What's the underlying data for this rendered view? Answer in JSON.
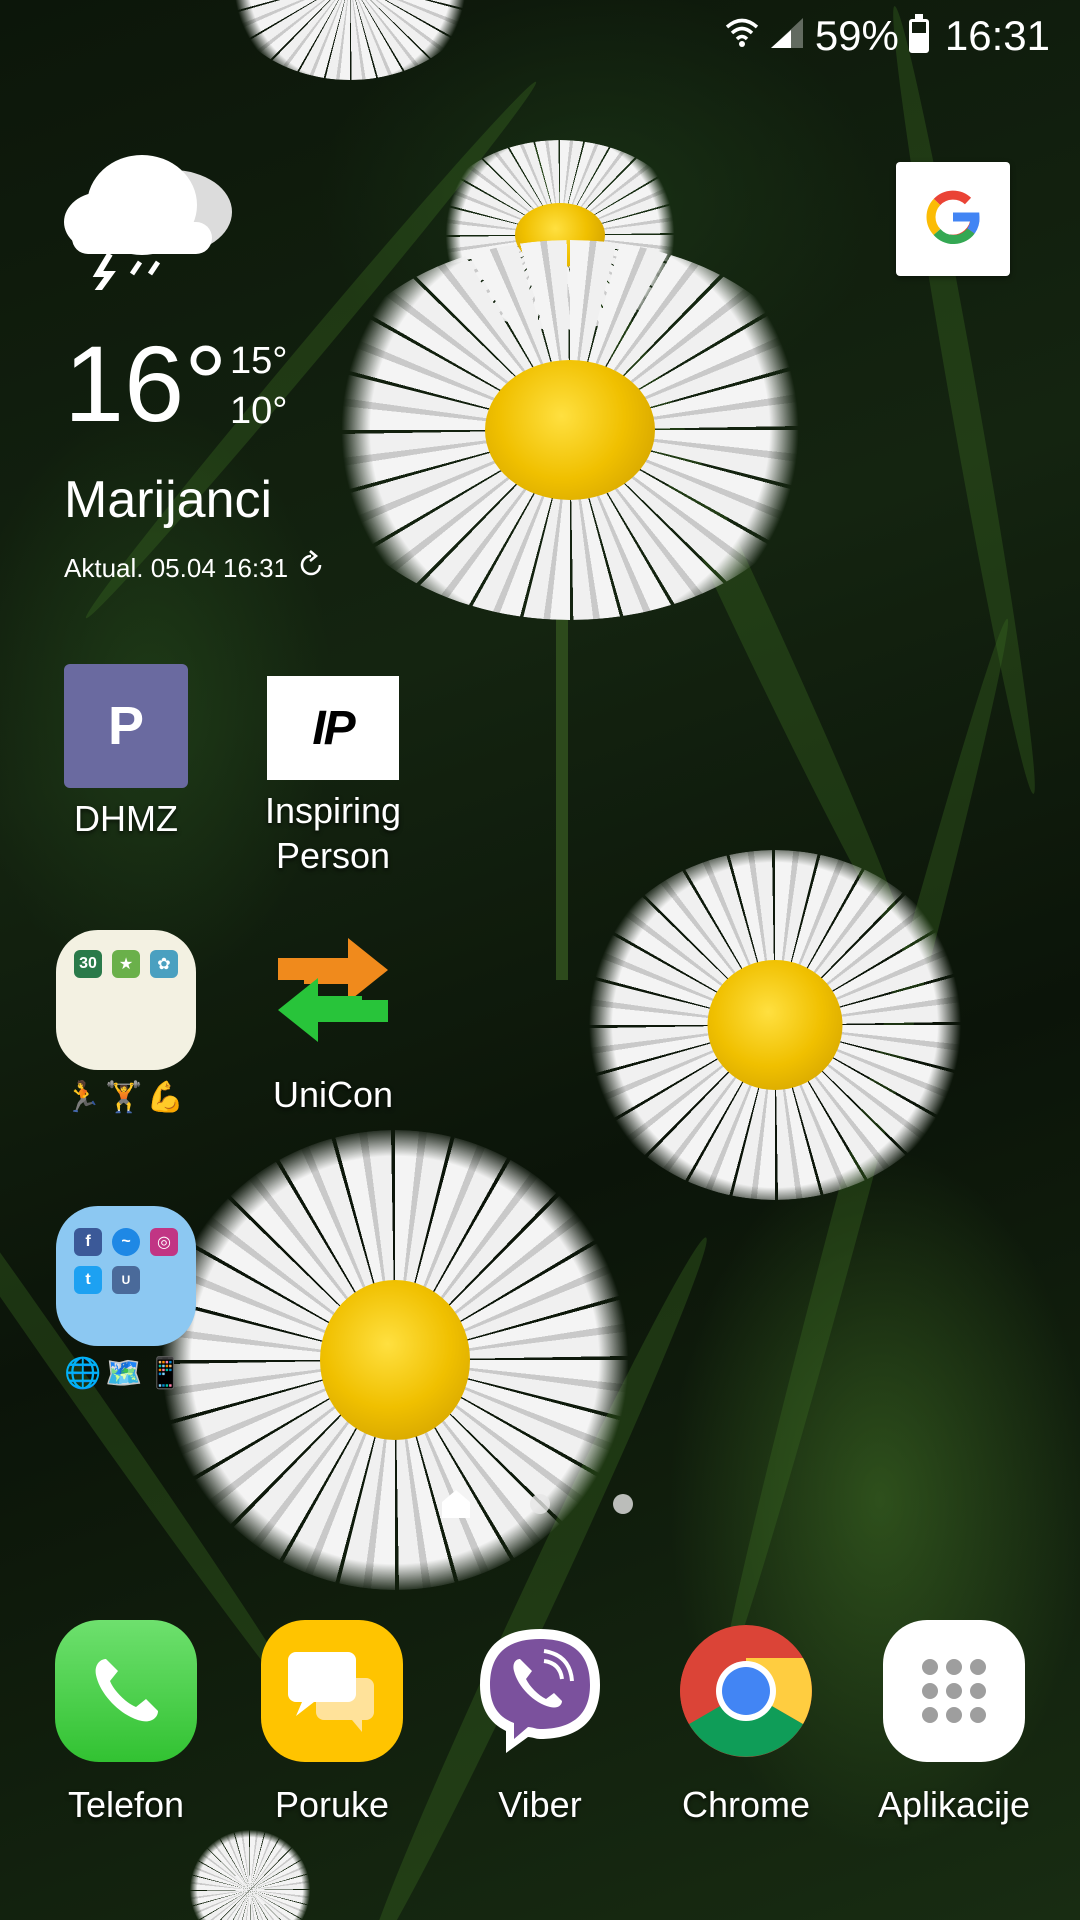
{
  "status_bar": {
    "battery_percent": "59%",
    "time": "16:31",
    "battery_level": 0.59,
    "icons": [
      "wifi-icon",
      "signal-icon",
      "battery-icon"
    ]
  },
  "weather": {
    "condition_icon": "thunderstorm-cloud-icon",
    "temperature": "16°",
    "high": "15°",
    "low": "10°",
    "location": "Marijanci",
    "updated_label": "Aktual. 05.04 16:31"
  },
  "google": {
    "icon": "google-g-icon"
  },
  "home_apps": [
    {
      "label": "DHMZ",
      "icon_text": "P",
      "icon": "dhmz-app-icon"
    },
    {
      "label": "Inspiring Person",
      "icon_text": "IP",
      "icon": "inspiring-person-app-icon"
    },
    {
      "label": "UniCon",
      "icon": "unicon-arrows-icon"
    }
  ],
  "folders": [
    {
      "name_emoji": "🏃🏋💪",
      "contents": [
        "30",
        "fitness",
        "yoga"
      ]
    },
    {
      "name_emoji": "🌐🗺️📱",
      "contents": [
        "f",
        "messenger",
        "instagram",
        "twitter",
        "U"
      ]
    }
  ],
  "page_indicator": {
    "pages": 3,
    "current": 0
  },
  "dock": [
    {
      "label": "Telefon",
      "icon": "phone-icon",
      "color": "#4cd94c"
    },
    {
      "label": "Poruke",
      "icon": "messages-icon",
      "color": "#ffc400"
    },
    {
      "label": "Viber",
      "icon": "viber-icon",
      "color": "#ffffff"
    },
    {
      "label": "Chrome",
      "icon": "chrome-icon",
      "color": "#ffffff"
    },
    {
      "label": "Aplikacije",
      "icon": "apps-grid-icon",
      "color": "#ffffff"
    }
  ]
}
